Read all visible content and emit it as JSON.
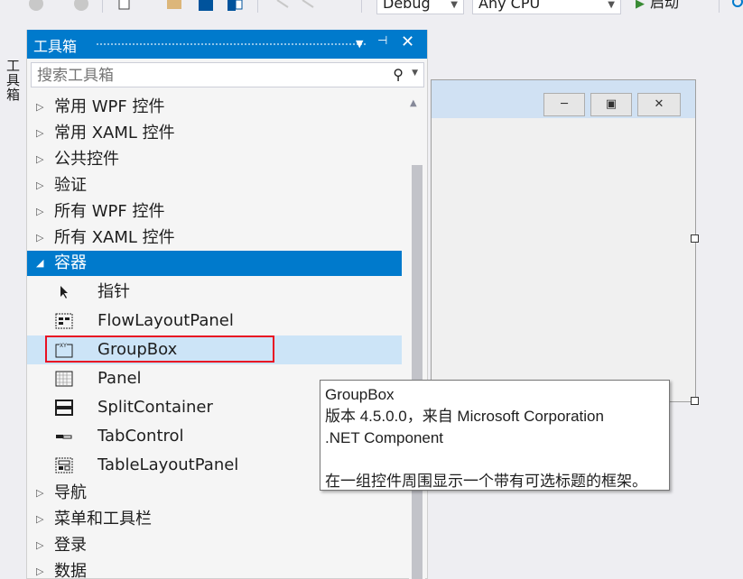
{
  "toolbar": {
    "config_combo": "Debug",
    "platform_combo": "Any CPU",
    "start_label": "启动"
  },
  "side_strip": {
    "tab_label": "工具箱"
  },
  "toolbox": {
    "title": "工具箱",
    "search_placeholder": "搜索工具箱",
    "categories_top": [
      {
        "label": "常用 WPF 控件"
      },
      {
        "label": "常用 XAML 控件"
      },
      {
        "label": "公共控件"
      },
      {
        "label": "验证"
      },
      {
        "label": "所有 WPF 控件"
      },
      {
        "label": "所有 XAML 控件"
      }
    ],
    "open_category": {
      "label": "容器"
    },
    "items": [
      {
        "label": "指针",
        "icon": "pointer-icon"
      },
      {
        "label": "FlowLayoutPanel",
        "icon": "flowlayoutpanel-icon"
      },
      {
        "label": "GroupBox",
        "icon": "groupbox-icon"
      },
      {
        "label": "Panel",
        "icon": "panel-icon"
      },
      {
        "label": "SplitContainer",
        "icon": "splitcontainer-icon"
      },
      {
        "label": "TabControl",
        "icon": "tabcontrol-icon"
      },
      {
        "label": "TableLayoutPanel",
        "icon": "tablelayoutpanel-icon"
      }
    ],
    "categories_bottom": [
      {
        "label": "导航"
      },
      {
        "label": "菜单和工具栏"
      },
      {
        "label": "登录"
      },
      {
        "label": "数据"
      }
    ]
  },
  "tooltip": {
    "title": "GroupBox",
    "version": "版本 4.5.0.0，来自 Microsoft Corporation",
    "kind": ".NET Component",
    "description": "在一组控件周围显示一个带有可选标题的框架。"
  },
  "colors": {
    "accent": "#007acc",
    "selected_item": "#cce4f7",
    "highlight_border": "#e81123"
  }
}
